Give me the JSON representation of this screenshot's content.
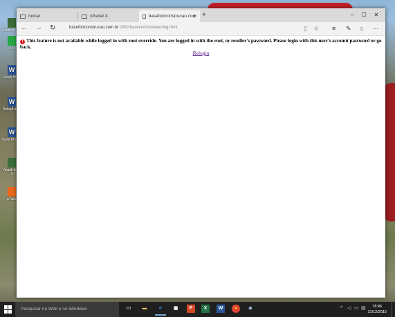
{
  "browser": {
    "tabs": [
      {
        "label": "Iniciar",
        "active": false
      },
      {
        "label": "cPanel X",
        "active": false
      },
      {
        "label": "basefortconstrucao.com",
        "active": true
      }
    ],
    "new_tab_symbol": "+",
    "window_controls": {
      "minimize": "–",
      "maximize": "☐",
      "close": "✕"
    },
    "nav": {
      "back": "←",
      "forward": "→",
      "refresh": "↻"
    },
    "address": {
      "domain": "basefortconstrucao.com.br",
      "path": ":2082/backend/rootwarning.html"
    },
    "toolbar_right": {
      "reading_view": "▯",
      "favorite": "☆",
      "hub": "≡",
      "note": "✎",
      "share": "⌂",
      "more": "···"
    }
  },
  "page": {
    "warning_icon": "!",
    "warning_text": "This feature is not available while logged in with root override. You are logged in with the root, or reseller's password. Please login with this user's account password or go back.",
    "relogin_link": "Relogin"
  },
  "desktop": {
    "icons": [
      {
        "label": "Fotos d Geo",
        "icon": "photo"
      },
      {
        "label": "Li",
        "icon": "app"
      },
      {
        "label": "Relaç Utiliz",
        "icon": "W"
      },
      {
        "label": "Relaçã amp",
        "icon": "W"
      },
      {
        "label": "Nada M Dest",
        "icon": "W"
      },
      {
        "label": "Visuali fotos 3",
        "icon": "photo"
      },
      {
        "label": "aTube",
        "icon": "media"
      }
    ]
  },
  "taskbar": {
    "search_placeholder": "Pesquisar na Web e no Windows",
    "apps": [
      "task-view",
      "file-explorer",
      "edge",
      "store",
      "powerpoint",
      "excel",
      "word",
      "chrome",
      "other"
    ],
    "tray": {
      "chevron": "^",
      "volume": "◁",
      "network": "▭",
      "notifications": "▤"
    },
    "clock_time": "18:46",
    "clock_date": "21/12/2015"
  },
  "colors": {
    "link_visited": "#551a8b",
    "warning_red": "#dd2222",
    "taskbar": "#1f1f1f",
    "tabbar": "#dadada"
  }
}
